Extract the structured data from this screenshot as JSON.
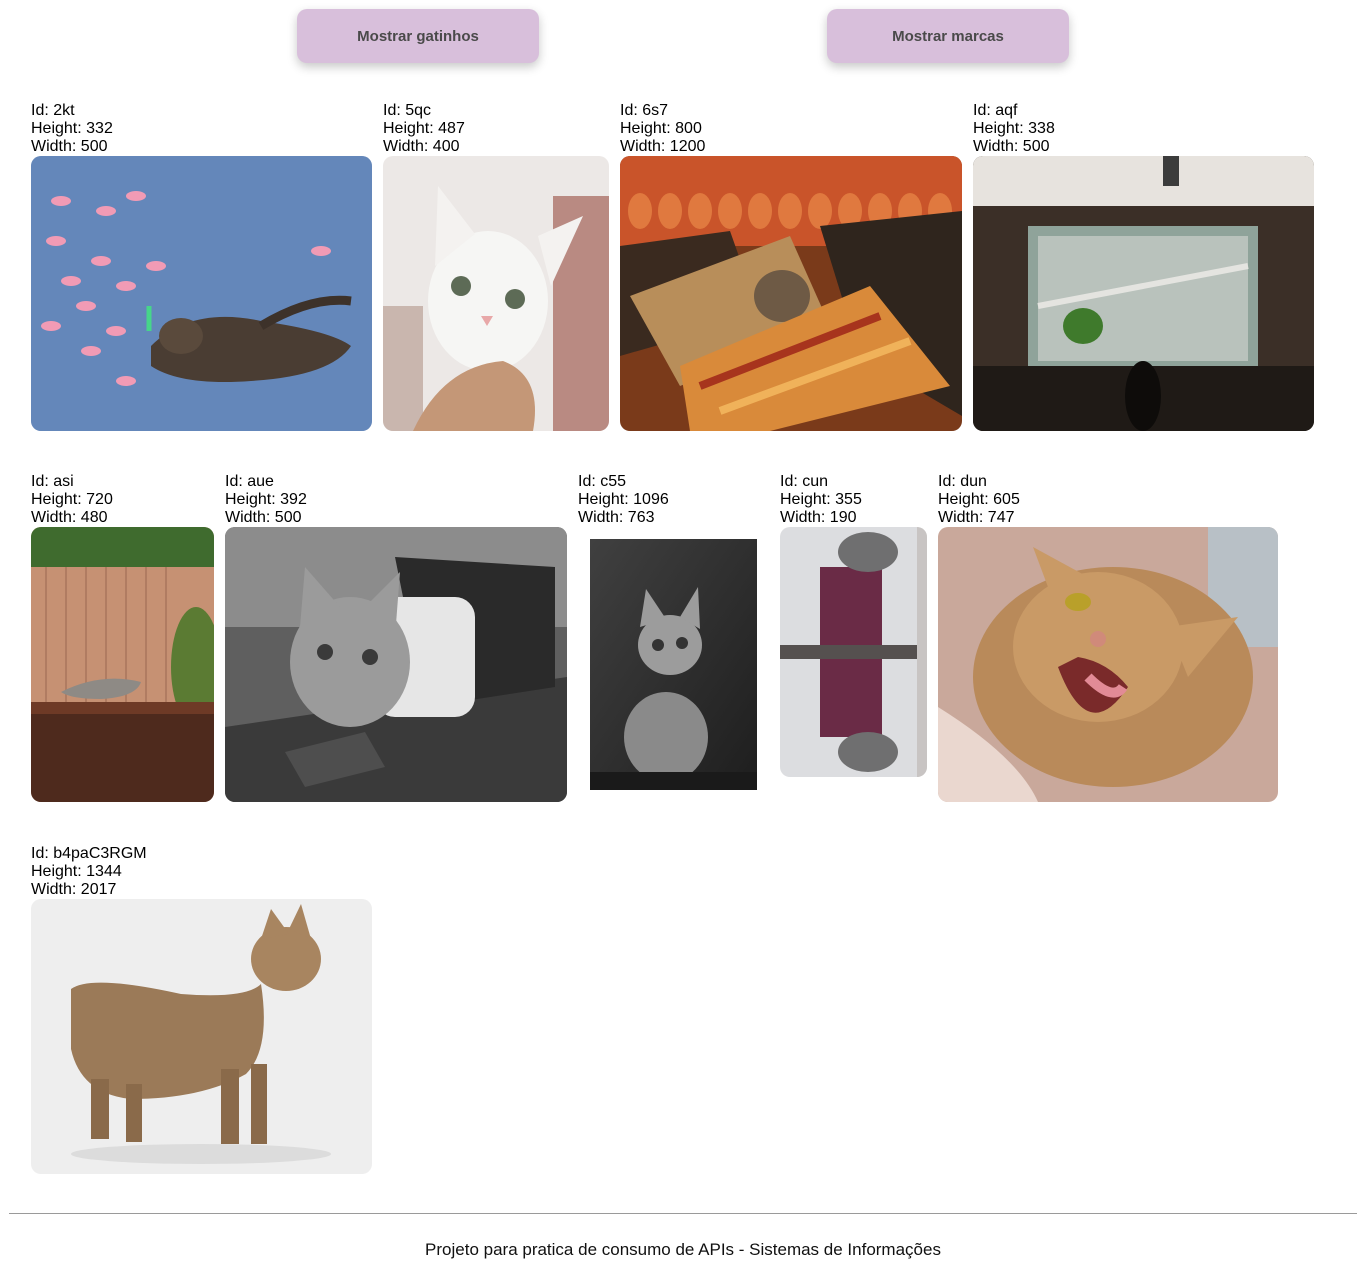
{
  "buttons": {
    "cats_label": "Mostrar gatinhos",
    "brands_label": "Mostrar marcas"
  },
  "labels": {
    "id": "Id: ",
    "height": "Height: ",
    "width": "Width: "
  },
  "cats": [
    {
      "id": "2kt",
      "height": "332",
      "width": "500"
    },
    {
      "id": "5qc",
      "height": "487",
      "width": "400"
    },
    {
      "id": "6s7",
      "height": "800",
      "width": "1200"
    },
    {
      "id": "aqf",
      "height": "338",
      "width": "500"
    },
    {
      "id": "asi",
      "height": "720",
      "width": "480"
    },
    {
      "id": "aue",
      "height": "392",
      "width": "500"
    },
    {
      "id": "c55",
      "height": "1096",
      "width": "763"
    },
    {
      "id": "cun",
      "height": "355",
      "width": "190"
    },
    {
      "id": "dun",
      "height": "605",
      "width": "747"
    },
    {
      "id": "b4paC3RGM",
      "height": "1344",
      "width": "2017"
    }
  ],
  "footer": {
    "text": "Projeto para pratica de consumo de APIs - Sistemas de Informações"
  }
}
